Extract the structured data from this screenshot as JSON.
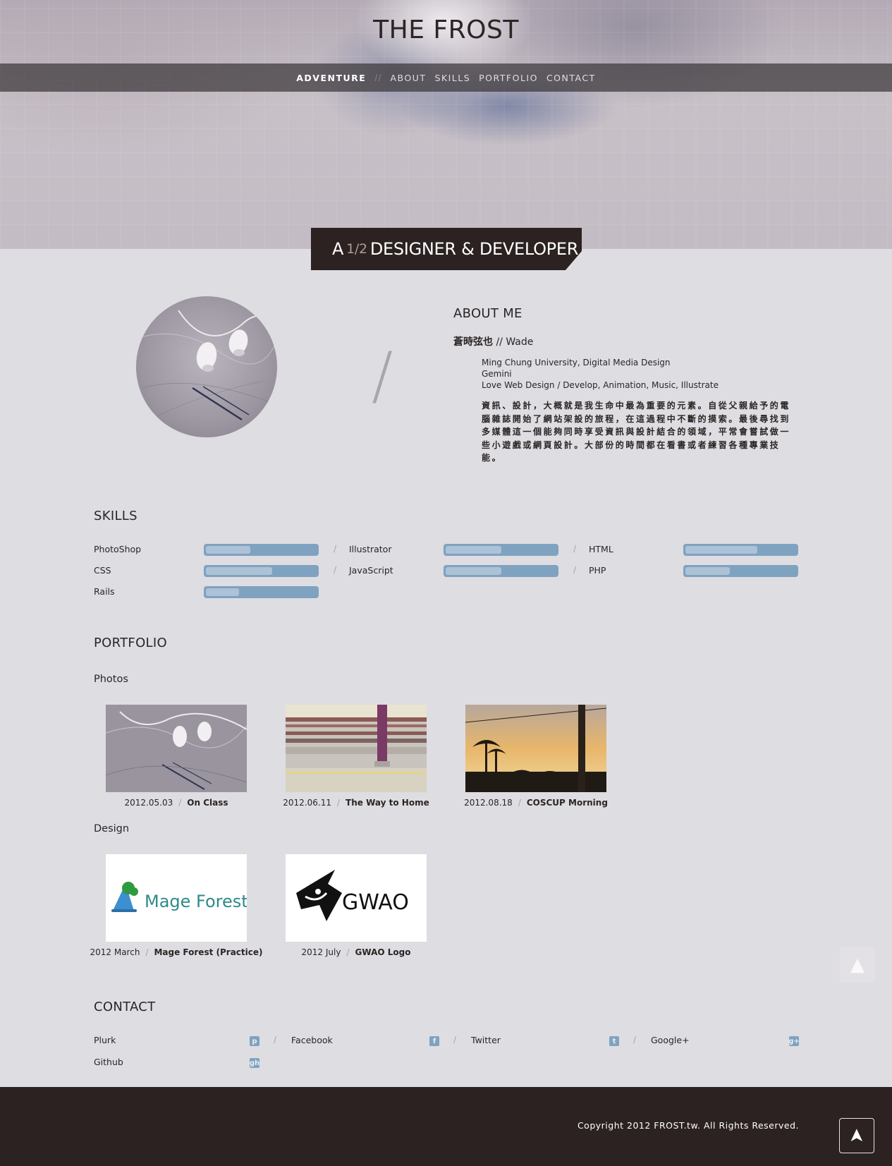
{
  "site": {
    "title": "THE FROST"
  },
  "nav": {
    "items": [
      "ADVENTURE",
      "//",
      "ABOUT",
      "SKILLS",
      "PORTFOLIO",
      "CONTACT"
    ]
  },
  "banner": {
    "prefix": "A",
    "half": "1/2",
    "suffix": "DESIGNER & DEVELOPER"
  },
  "about": {
    "heading": "ABOUT ME",
    "name_cn": "蒼時弦也",
    "name_sep": "//",
    "name_en": "Wade",
    "lines": [
      "Ming Chung University, Digital Media Design",
      "Gemini",
      "Love Web Design / Develop, Animation, Music, Illustrate"
    ],
    "description": "資訊、設計，大概就是我生命中最為重要的元素。自從父親給予的電腦雜誌開始了網站架設的旅程，在這過程中不斷的摸索。最後尋找到多媒體這一個能夠同時享受資訊與設計結合的領域，平常會嘗試做一些小遊戲或網頁設計。大部份的時間都在看書或者練習各種專業技能。"
  },
  "skills": {
    "heading": "SKILLS",
    "items": [
      {
        "name": "PhotoShop",
        "level": 0.4
      },
      {
        "name": "Illustrator",
        "level": 0.5
      },
      {
        "name": "HTML",
        "level": 0.65
      },
      {
        "name": "CSS",
        "level": 0.6
      },
      {
        "name": "JavaScript",
        "level": 0.5
      },
      {
        "name": "PHP",
        "level": 0.4
      },
      {
        "name": "Rails",
        "level": 0.3
      }
    ],
    "separator": "/"
  },
  "portfolio": {
    "heading": "PORTFOLIO",
    "photos_heading": "Photos",
    "design_heading": "Design",
    "separator": "/",
    "photos": [
      {
        "date": "2012.05.03",
        "title": "On Class"
      },
      {
        "date": "2012.06.11",
        "title": "The Way to Home"
      },
      {
        "date": "2012.08.18",
        "title": "COSCUP Morning"
      }
    ],
    "design": [
      {
        "date": "2012 March",
        "title": "Mage Forest (Practice)",
        "logo_text": "Mage Forest"
      },
      {
        "date": "2012 July",
        "title": "GWAO Logo",
        "logo_text": "GWAO"
      }
    ]
  },
  "contact": {
    "heading": "CONTACT",
    "separator": "/",
    "items": [
      {
        "label": "Plurk",
        "icon": "plurk-icon",
        "glyph": "p"
      },
      {
        "label": "Facebook",
        "icon": "facebook-icon",
        "glyph": "f"
      },
      {
        "label": "Twitter",
        "icon": "twitter-icon",
        "glyph": "t"
      },
      {
        "label": "Google+",
        "icon": "google-plus-icon",
        "glyph": "g+"
      },
      {
        "label": "Github",
        "icon": "github-icon",
        "glyph": "gh"
      }
    ]
  },
  "footer": {
    "copyright": "Copyright 2012 FROST.tw. All Rights Reserved."
  },
  "colors": {
    "accent": "#7fa2c0",
    "dark": "#2b2221",
    "background": "#dedde2"
  },
  "icons": {
    "back_to_top": "arrow-up-icon"
  }
}
